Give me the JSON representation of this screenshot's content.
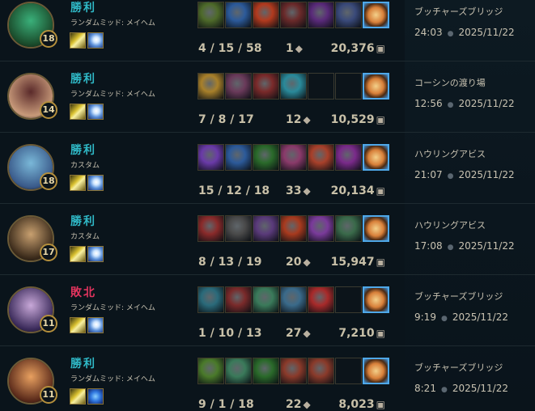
{
  "matches": [
    {
      "result": "勝利",
      "result_type": "win",
      "mode": "ランダムミッド: メイヘム",
      "level": "18",
      "kda": "4 / 15 / 58",
      "cs": "1",
      "gold": "20,376",
      "map": "ブッチャーズブリッジ",
      "duration": "24:03",
      "date": "2025/11/22",
      "spells": [
        "ghost",
        "flash"
      ],
      "items": [
        "#4e6a2a",
        "#2c5a9a",
        "#b23a1e",
        "#6a2a2a",
        "#5a2a7a",
        "#3a4a7a"
      ]
    },
    {
      "result": "勝利",
      "result_type": "win",
      "mode": "ランダムミッド: メイヘム",
      "level": "14",
      "kda": "7 / 8 / 17",
      "cs": "12",
      "gold": "10,529",
      "map": "コーシンの渡り場",
      "duration": "12:56",
      "date": "2025/11/22",
      "spells": [
        "ghost",
        "flash"
      ],
      "items": [
        "#a8802a",
        "#6a3a5a",
        "#7a2a2a",
        "#2a8a9a",
        "empty",
        "empty"
      ]
    },
    {
      "result": "勝利",
      "result_type": "win",
      "mode": "カスタム",
      "level": "18",
      "kda": "15 / 12 / 18",
      "cs": "33",
      "gold": "20,134",
      "map": "ハウリングアビス",
      "duration": "21:07",
      "date": "2025/11/22",
      "spells": [
        "ghost",
        "flash"
      ],
      "items": [
        "#6a3aa8",
        "#2c5a9a",
        "#2a6a2a",
        "#8a3a6a",
        "#a8402a",
        "#7a2a8a"
      ]
    },
    {
      "result": "勝利",
      "result_type": "win",
      "mode": "カスタム",
      "level": "17",
      "kda": "8 / 13 / 19",
      "cs": "20",
      "gold": "15,947",
      "map": "ハウリングアビス",
      "duration": "17:08",
      "date": "2025/11/22",
      "spells": [
        "ghost",
        "flash"
      ],
      "items": [
        "#8a2a2a",
        "#4a4a4a",
        "#5a3a7a",
        "#a83a1e",
        "#7a3a9a",
        "#3a6a4a"
      ]
    },
    {
      "result": "敗北",
      "result_type": "loss",
      "mode": "ランダムミッド: メイヘム",
      "level": "11",
      "kda": "1 / 10 / 13",
      "cs": "27",
      "gold": "7,210",
      "map": "ブッチャーズブリッジ",
      "duration": "9:19",
      "date": "2025/11/22",
      "spells": [
        "ghost",
        "flash"
      ],
      "items": [
        "#2a6a7a",
        "#7a2a2a",
        "#3a7a5a",
        "#3a6a8a",
        "#a82a2a",
        "empty"
      ]
    },
    {
      "result": "勝利",
      "result_type": "win",
      "mode": "ランダムミッド: メイヘム",
      "level": "11",
      "kda": "9 / 1 / 18",
      "cs": "22",
      "gold": "8,023",
      "map": "ブッチャーズブリッジ",
      "duration": "8:21",
      "date": "2025/11/22",
      "spells": [
        "ghost",
        "tp"
      ],
      "items": [
        "#4a7a2a",
        "#3a7a5a",
        "#2a6a2a",
        "#8a3a2a",
        "#8a3a2a",
        "empty"
      ]
    }
  ],
  "portrait_colors": [
    [
      "#1a4a2a",
      "#3ab07a"
    ],
    [
      "#c89a7a",
      "#5a2a2a"
    ],
    [
      "#3a5a8a",
      "#7ab8d8"
    ],
    [
      "#3a2a1a",
      "#c8a070"
    ],
    [
      "#3a2a5a",
      "#c8a8d8"
    ],
    [
      "#5a2a1a",
      "#e8a060"
    ]
  ]
}
